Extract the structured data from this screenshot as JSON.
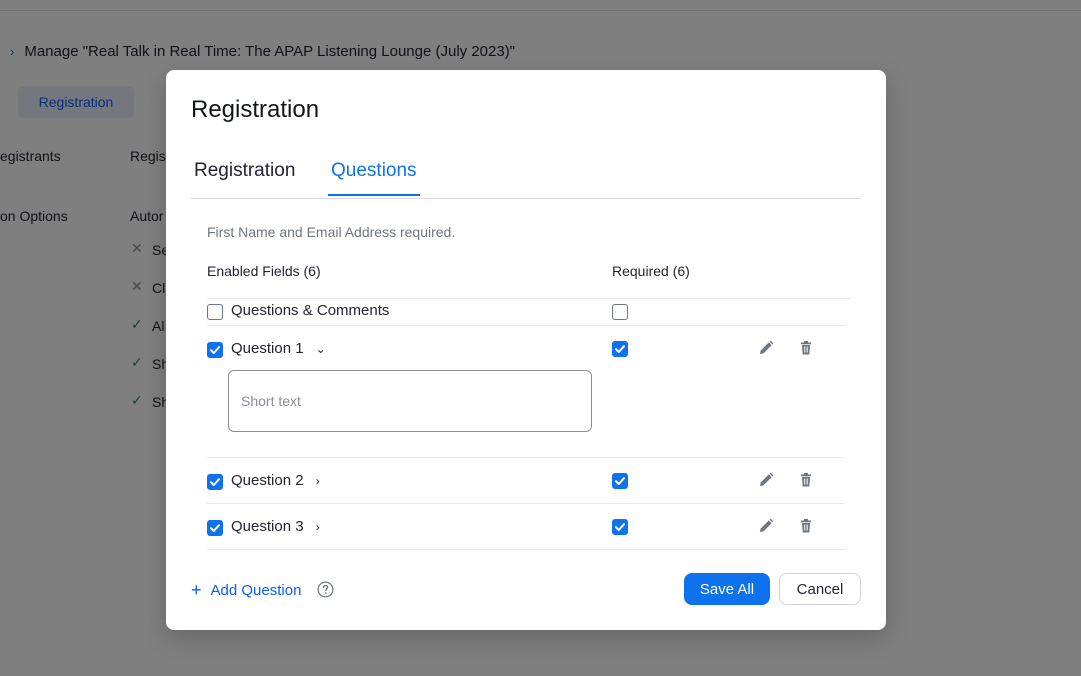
{
  "background": {
    "breadcrumb_chevron": "›",
    "breadcrumb_text": "Manage \"Real Talk in Real Time: The APAP Listening Lounge (July 2023)\"",
    "tab_label": "Registration",
    "left_labels": [
      "egistrants",
      "on Options"
    ],
    "right_texts": [
      "Regis",
      "Autor"
    ],
    "option_rows": [
      {
        "mark": "✕",
        "text": "Se",
        "status": "off"
      },
      {
        "mark": "✕",
        "text": "Cl",
        "status": "off"
      },
      {
        "mark": "✓",
        "text": "Al",
        "status": "on"
      },
      {
        "mark": "✓",
        "text": "Sh",
        "status": "on"
      },
      {
        "mark": "✓",
        "text": "Sh",
        "status": "on"
      }
    ]
  },
  "modal": {
    "title": "Registration",
    "tabs": [
      {
        "label": "Registration",
        "active": false
      },
      {
        "label": "Questions",
        "active": true
      }
    ],
    "note": "First Name and Email Address required.",
    "enabled_header": "Enabled Fields (6)",
    "required_header": "Required (6)",
    "rows": [
      {
        "label": "Questions & Comments",
        "enabled": false,
        "required": false,
        "expandable": false,
        "actions": false
      },
      {
        "label": "Question 1",
        "enabled": true,
        "required": true,
        "expanded": true,
        "caret": "⌄",
        "actions": true,
        "input_placeholder": "Short text"
      },
      {
        "label": "Question 2",
        "enabled": true,
        "required": true,
        "expanded": false,
        "caret": "›",
        "actions": true
      },
      {
        "label": "Question 3",
        "enabled": true,
        "required": true,
        "expanded": false,
        "caret": "›",
        "actions": true
      }
    ],
    "add_question": {
      "plus": "+",
      "label": "Add Question"
    },
    "save_label": "Save All",
    "cancel_label": "Cancel",
    "icons": {
      "edit": "pencil-icon",
      "delete": "trash-icon",
      "help": "help-circle-icon",
      "check": "checkmark-icon"
    },
    "colors": {
      "accent": "#0e72ed",
      "link": "#0b5cff",
      "text": "#232333",
      "muted": "#6e7680"
    }
  }
}
